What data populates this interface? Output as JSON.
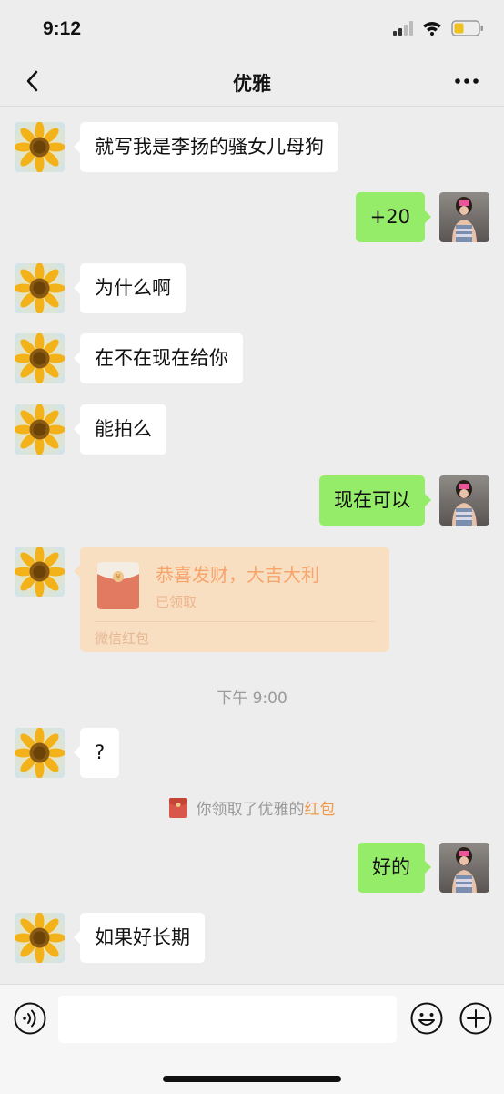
{
  "status_bar": {
    "time": "9:12"
  },
  "header": {
    "title": "优雅"
  },
  "messages": [
    {
      "text": "就写我是李扬的骚女儿母狗"
    },
    {
      "text": "+20"
    },
    {
      "text": "为什么啊"
    },
    {
      "text": "在不在现在给你"
    },
    {
      "text": "能拍么"
    },
    {
      "text": "现在可以"
    },
    {
      "text": "?"
    },
    {
      "text": "好的"
    },
    {
      "text": "如果好长期"
    }
  ],
  "red_packet": {
    "title": "恭喜发财，大吉大利",
    "status": "已领取",
    "footer": "微信红包"
  },
  "timestamp": "下午 9:00",
  "system_message": {
    "prefix": "你领取了优雅的",
    "link": "红包"
  },
  "colors": {
    "background": "#ededed",
    "sent_bubble": "#95ec69",
    "received_bubble": "#ffffff",
    "red_packet_bg": "#f8dfc2",
    "red_packet_text": "#f7a46a",
    "link": "#f09a4a"
  },
  "icons": {
    "status": [
      "signal-icon",
      "wifi-icon",
      "battery-icon"
    ],
    "header": [
      "back-chevron-icon",
      "more-dots-icon"
    ],
    "input_bar": [
      "voice-icon",
      "emoji-icon",
      "plus-icon"
    ]
  }
}
